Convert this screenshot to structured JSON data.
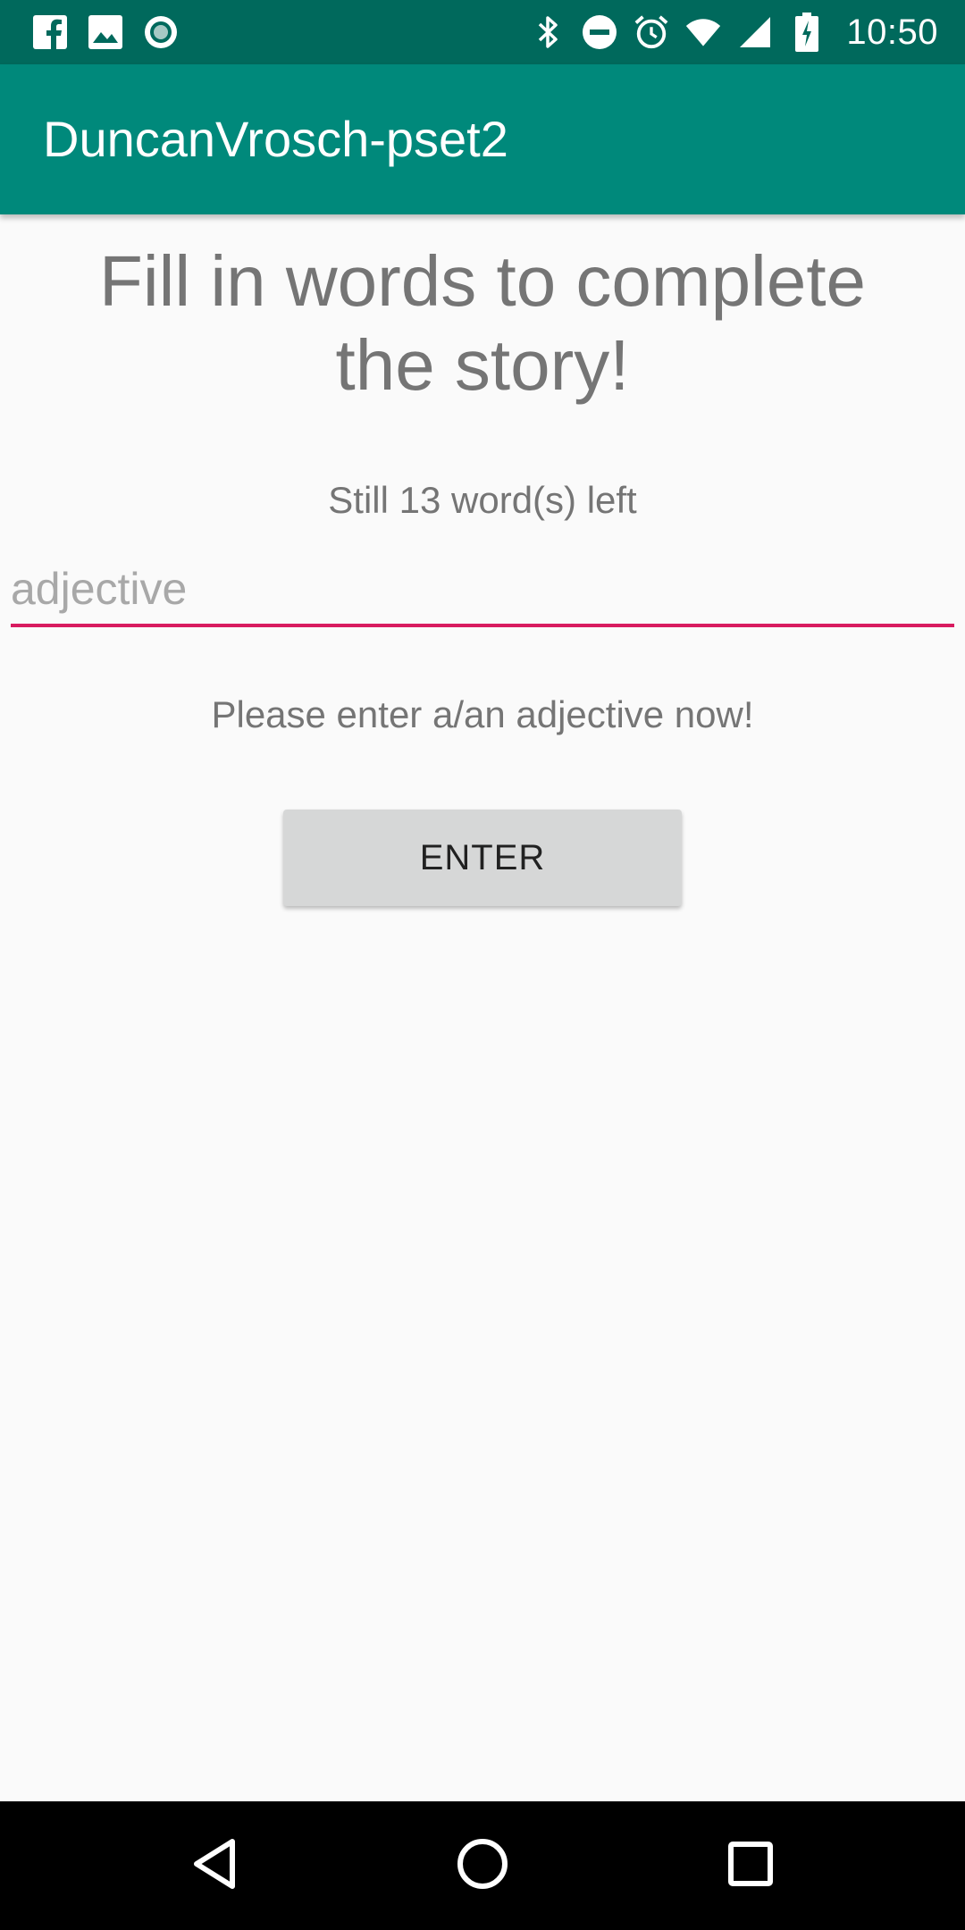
{
  "status_bar": {
    "time": "10:50",
    "left_icons": [
      "facebook-icon",
      "gallery-icon",
      "record-icon"
    ],
    "right_icons": [
      "bluetooth-icon",
      "do-not-disturb-icon",
      "alarm-icon",
      "wifi-icon",
      "cell-signal-icon",
      "battery-icon"
    ]
  },
  "app_bar": {
    "title": "DuncanVrosch-pset2"
  },
  "main": {
    "headline": "Fill in words to complete the story!",
    "words_left": "Still 13 word(s) left",
    "input": {
      "value": "",
      "placeholder": "adjective"
    },
    "prompt": "Please enter a/an adjective now!",
    "enter_button": "ENTER"
  },
  "nav_bar": {
    "icons": [
      "back-icon",
      "home-icon",
      "recents-icon"
    ]
  },
  "colors": {
    "status_bar": "#00695c",
    "app_bar": "#00897b",
    "input_underline": "#d81b60",
    "button": "#d6d7d7",
    "background": "#fafafa"
  }
}
